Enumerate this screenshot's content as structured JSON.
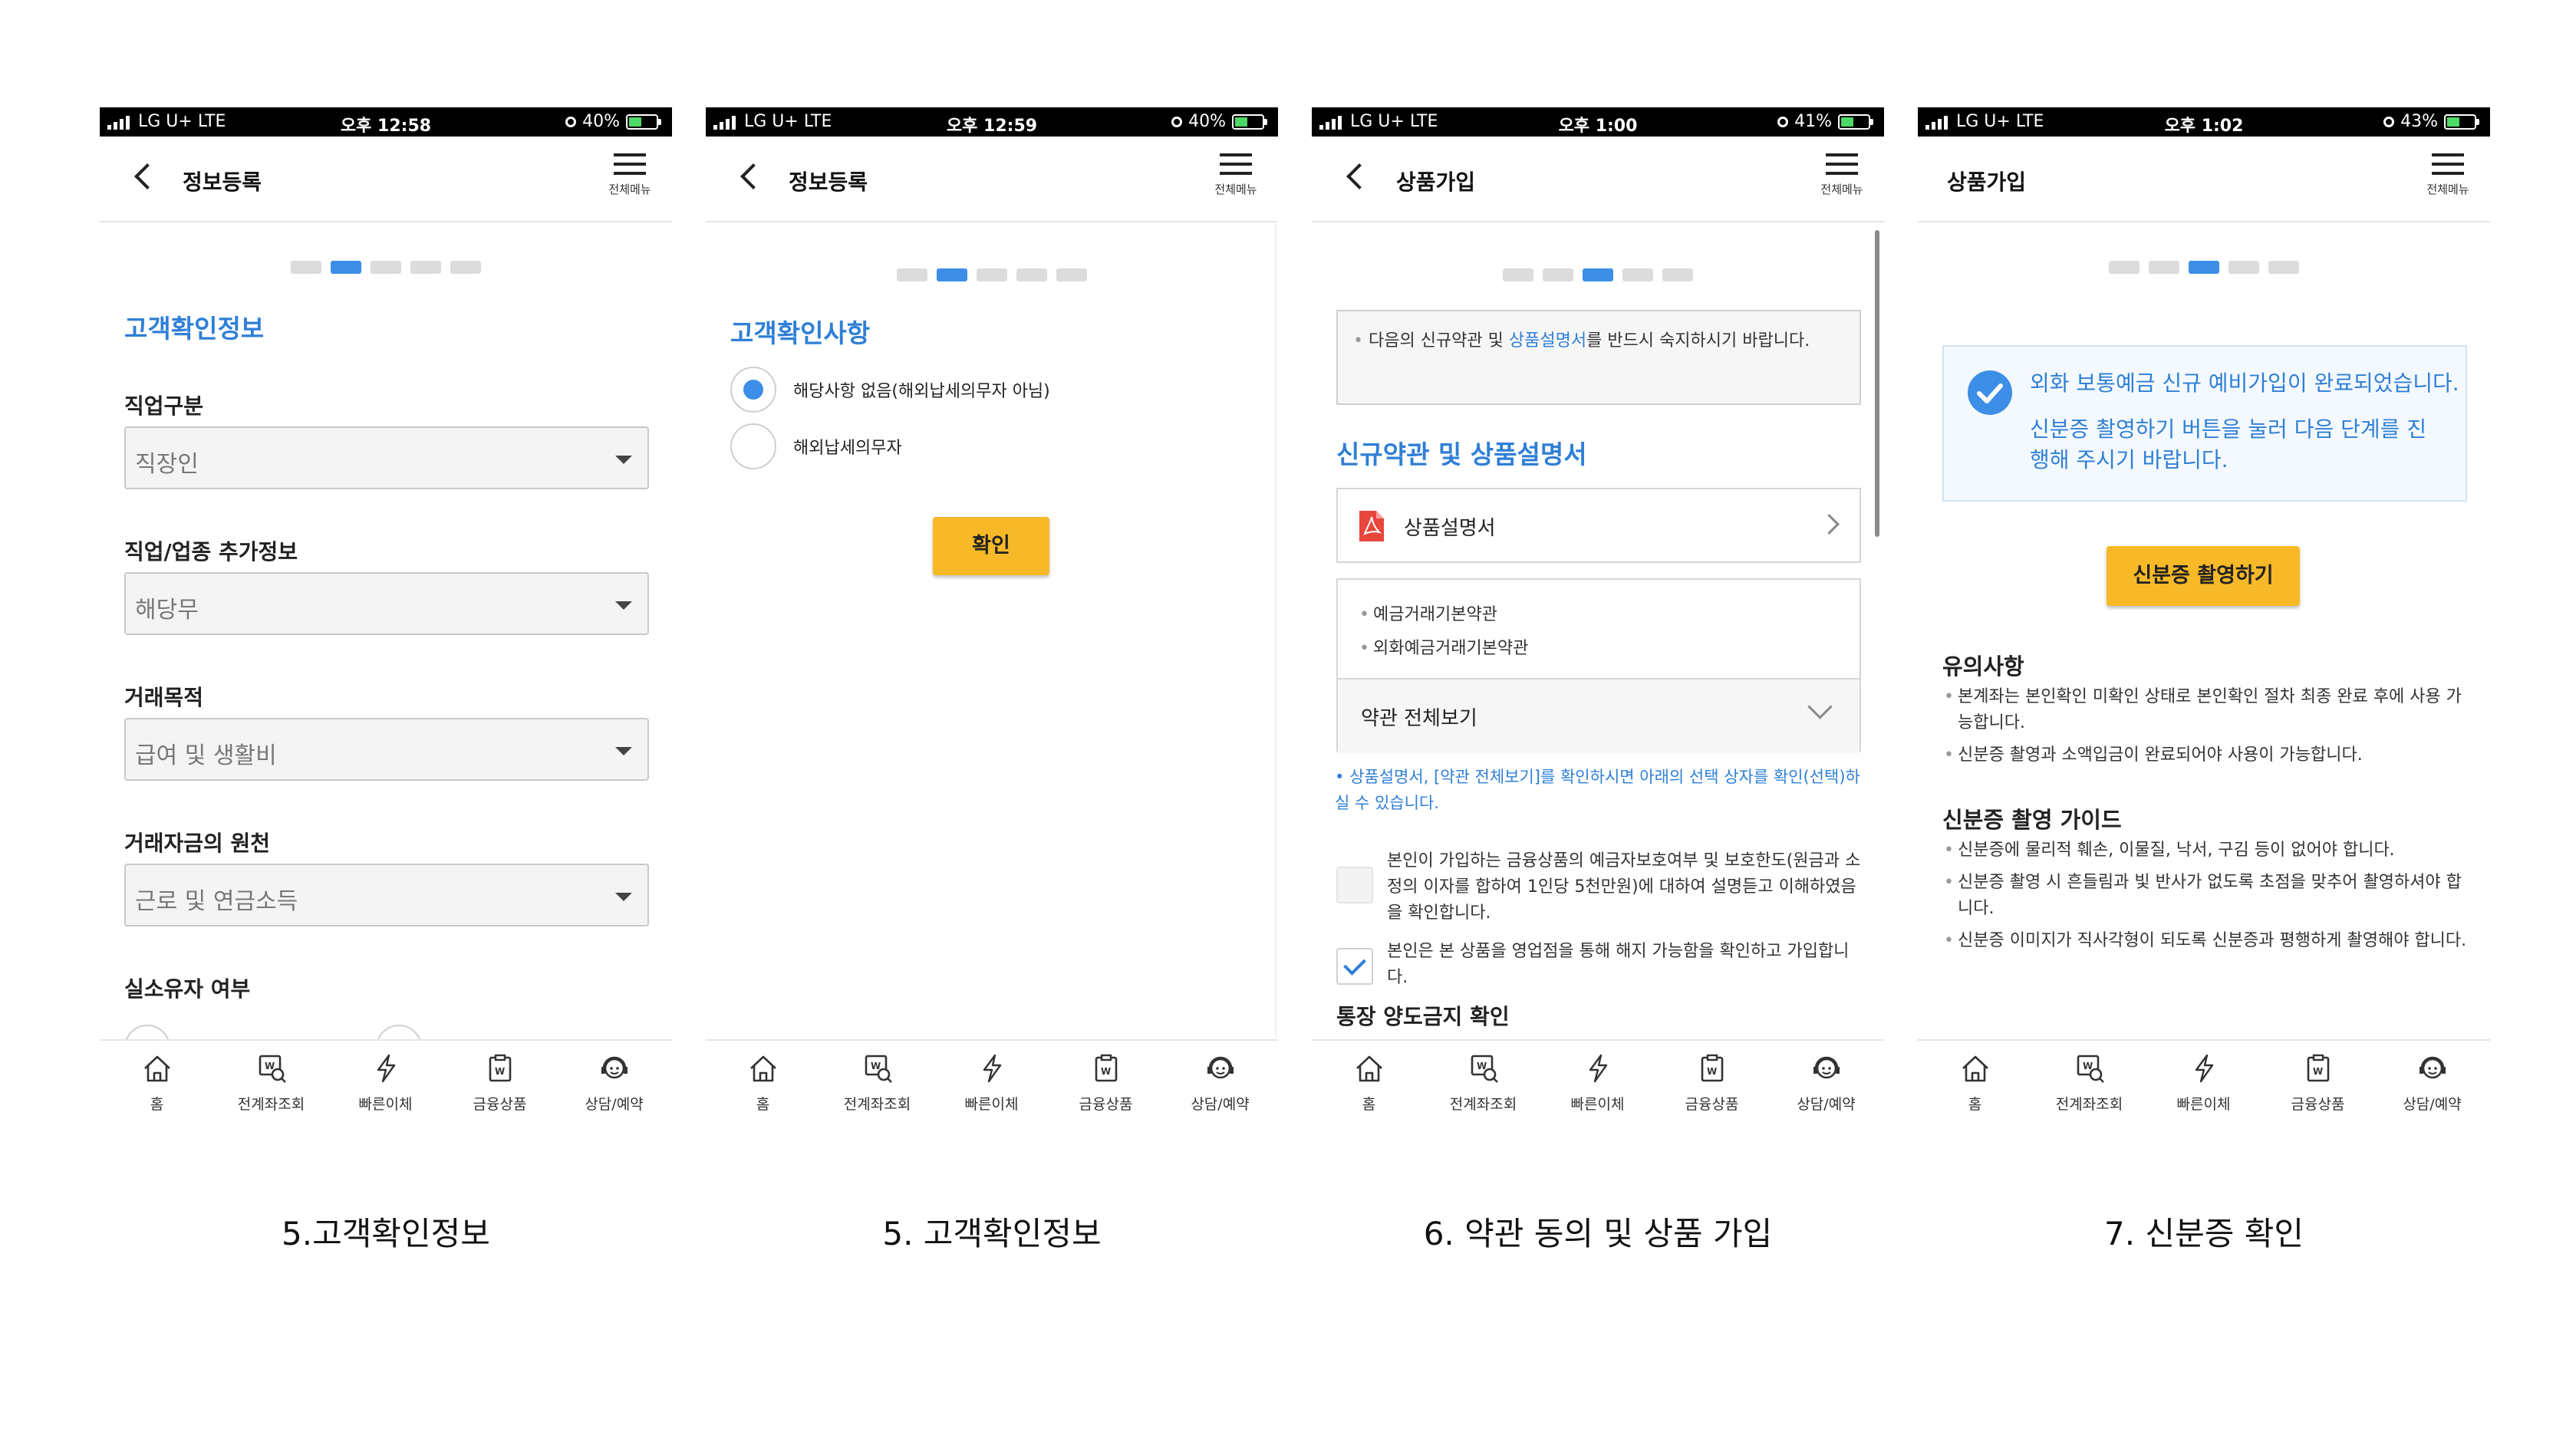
{
  "status": {
    "carrier": "LG U+  LTE",
    "times": [
      "오후 12:58",
      "오후 12:59",
      "오후 1:00",
      "오후 1:02"
    ],
    "battery": [
      "40%",
      "40%",
      "41%",
      "43%"
    ]
  },
  "menu_label": "전체메뉴",
  "tabs": [
    "홈",
    "전계좌조회",
    "빠른이체",
    "금융상품",
    "상담/예약"
  ],
  "screen1": {
    "title": "정보등록",
    "section": "고객확인정보",
    "fields": [
      {
        "label": "직업구분",
        "value": "직장인"
      },
      {
        "label": "직업/업종 추가정보",
        "value": "해당무"
      },
      {
        "label": "거래목적",
        "value": "급여 및 생활비"
      },
      {
        "label": "거래자금의 원천",
        "value": "근로 및 연금소득"
      }
    ],
    "last_label": "실소유자 여부",
    "caption": "5.고객확인정보"
  },
  "screen2": {
    "title": "정보등록",
    "section": "고객확인사항",
    "option1": "해당사항 없음(해외납세의무자 아님)",
    "option2": "해외납세의무자",
    "confirm": "확인",
    "caption": "5. 고객확인정보"
  },
  "screen3": {
    "title": "상품가입",
    "notice_pre": "다음의 신규약관 및 ",
    "notice_link": "상품설명서",
    "notice_post": "를 반드시 숙지하시기 바랍니다.",
    "section": "신규약관 및 상품설명서",
    "doc": "상품설명서",
    "terms": [
      "예금거래기본약관",
      "외화예금거래기본약관"
    ],
    "view_all": "약관 전체보기",
    "hint": "상품설명서, [약관 전체보기]를 확인하시면 아래의 선택 상자를 확인(선택)하실 수 있습니다.",
    "check1": "본인이 가입하는 금융상품의 예금자보호여부 및 보호한도(원금과 소정의 이자를 합하여 1인당 5천만원)에 대하여 설명듣고 이해하였음을 확인합니다.",
    "check2": "본인은 본 상품을 영업점을 통해 해지 가능함을 확인하고 가입합니다.",
    "next_section": "통장 양도금지 확인",
    "caption": "6. 약관 동의 및 상품 가입"
  },
  "screen4": {
    "title": "상품가입",
    "done_line1": "외화 보통예금 신규 예비가입이 완료되었습니다.",
    "done_line2": "신분증 촬영하기 버튼을 눌러 다음 단계를 진행해 주시기 바랍니다.",
    "button": "신분증 촬영하기",
    "notice_title": "유의사항",
    "notices": [
      "본계좌는 본인확인 미확인 상태로 본인확인 절차 최종 완료 후에 사용 가능합니다.",
      "신분증 촬영과 소액입금이 완료되어야 사용이 가능합니다."
    ],
    "guide_title": "신분증 촬영 가이드",
    "guides": [
      "신분증에 물리적 훼손, 이물질, 낙서, 구김 등이 없어야 합니다.",
      "신분증 촬영 시 흔들림과 빛 반사가 없도록 초점을 맞추어 촬영하셔야 합니다.",
      "신분증 이미지가 직사각형이 되도록 신분증과 평행하게 촬영해야 합니다."
    ],
    "caption": "7. 신분증 확인"
  },
  "colors": {
    "accent": "#2f7fd6",
    "button": "#f7b928",
    "step_active": "#3d8ee6"
  }
}
